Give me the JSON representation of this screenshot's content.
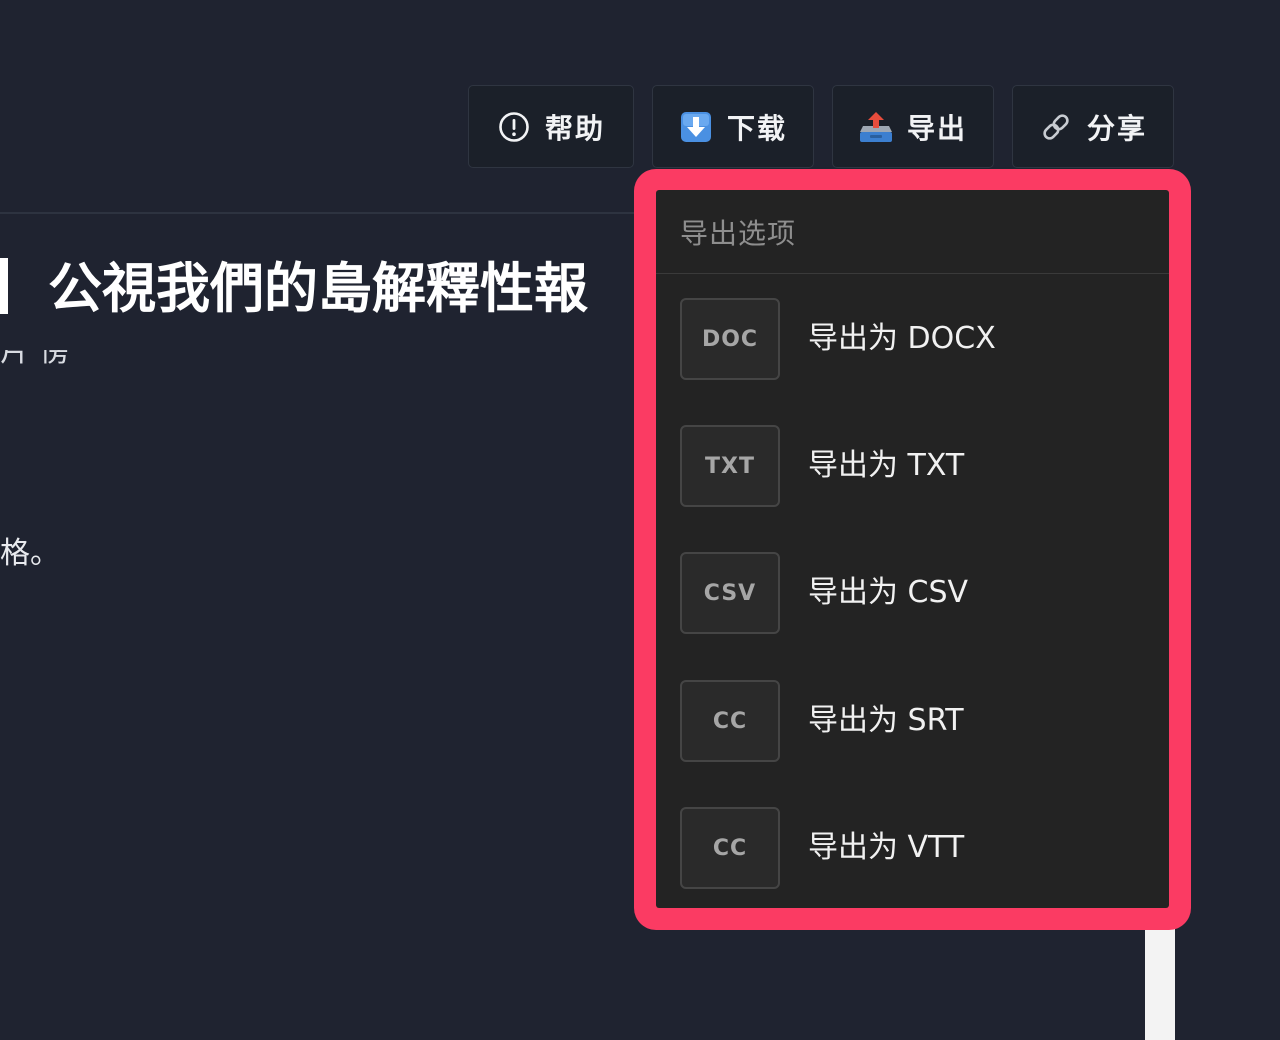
{
  "toolbar": {
    "buttons": [
      {
        "id": "help",
        "label": "帮助",
        "icon": "alert-circle-icon"
      },
      {
        "id": "download",
        "label": "下载",
        "icon": "download-arrow-icon"
      },
      {
        "id": "export",
        "label": "导出",
        "icon": "outbox-tray-icon"
      },
      {
        "id": "share",
        "label": "分享",
        "icon": "link-icon"
      }
    ]
  },
  "page": {
    "title": "公視我們的島解釋性報",
    "clipped_line": "片 傍",
    "body_fragment": "格。"
  },
  "export_menu": {
    "header": "导出选项",
    "items": [
      {
        "badge": "DOC",
        "label": "导出为 DOCX"
      },
      {
        "badge": "TXT",
        "label": "导出为 TXT"
      },
      {
        "badge": "CSV",
        "label": "导出为 CSV"
      },
      {
        "badge": "CC",
        "label": "导出为 SRT"
      },
      {
        "badge": "CC",
        "label": "导出为 VTT"
      }
    ]
  },
  "colors": {
    "background": "#1f2330",
    "highlight": "#fb3b63",
    "menu_bg": "#232323"
  }
}
